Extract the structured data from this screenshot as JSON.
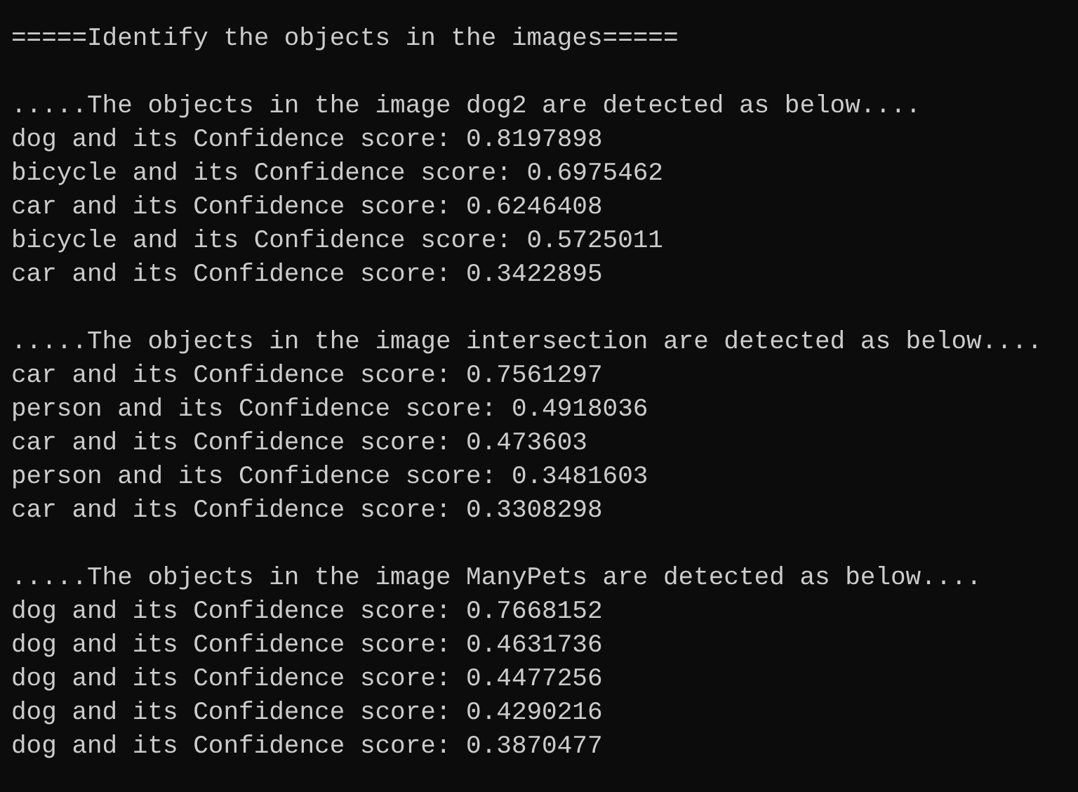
{
  "console": {
    "title": "=====Identify the objects in the images=====",
    "sections": [
      {
        "heading": ".....The objects in the image dog2 are detected as below....",
        "results": [
          "dog and its Confidence score: 0.8197898",
          "bicycle and its Confidence score: 0.6975462",
          "car and its Confidence score: 0.6246408",
          "bicycle and its Confidence score: 0.5725011",
          "car and its Confidence score: 0.3422895"
        ]
      },
      {
        "heading": ".....The objects in the image intersection are detected as below....",
        "results": [
          "car and its Confidence score: 0.7561297",
          "person and its Confidence score: 0.4918036",
          "car and its Confidence score: 0.473603",
          "person and its Confidence score: 0.3481603",
          "car and its Confidence score: 0.3308298"
        ]
      },
      {
        "heading": ".....The objects in the image ManyPets are detected as below....",
        "results": [
          "dog and its Confidence score: 0.7668152",
          "dog and its Confidence score: 0.4631736",
          "dog and its Confidence score: 0.4477256",
          "dog and its Confidence score: 0.4290216",
          "dog and its Confidence score: 0.3870477"
        ]
      }
    ]
  }
}
